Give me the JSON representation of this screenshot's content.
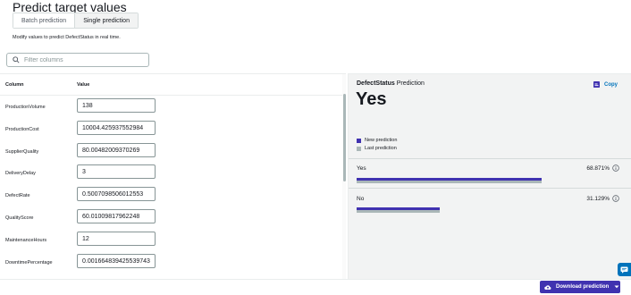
{
  "page": {
    "title": "Predict target values",
    "subtitle": "Modify values to predict DefectStatus in real time."
  },
  "tabs": [
    {
      "label": "Batch prediction",
      "active": false
    },
    {
      "label": "Single prediction",
      "active": true
    }
  ],
  "filter": {
    "placeholder": "Filter columns",
    "icon": "search-icon"
  },
  "table": {
    "column_header": "Column",
    "value_header": "Value",
    "rows": [
      {
        "column": "ProductionVolume",
        "value": "138"
      },
      {
        "column": "ProductionCost",
        "value": "10004.425937552984"
      },
      {
        "column": "SupplierQuality",
        "value": "80.00482009370269"
      },
      {
        "column": "DeliveryDelay",
        "value": "3"
      },
      {
        "column": "DefectRate",
        "value": "0.5007098506012553"
      },
      {
        "column": "QualityScore",
        "value": "60.01009817962248"
      },
      {
        "column": "MaintenanceHours",
        "value": "12"
      },
      {
        "column": "DowntimePercentage",
        "value": "0.0016648394255397436"
      }
    ]
  },
  "prediction": {
    "target_bold": "DefectStatus",
    "target_suffix": " Prediction",
    "copy_label": "Copy",
    "copy_icon": "copy-icon",
    "value": "Yes",
    "legend": [
      {
        "label": "New prediction",
        "color": "#4032b0"
      },
      {
        "label": "Last prediction",
        "color": "#aab7b8"
      }
    ],
    "classes": [
      {
        "label": "Yes",
        "pct_text": "68.871%",
        "new_fraction": 0.68871,
        "last_fraction": 0.68871
      },
      {
        "label": "No",
        "pct_text": "31.129%",
        "new_fraction": 0.31129,
        "last_fraction": 0.31129
      }
    ]
  },
  "footer": {
    "download_label": "Download prediction",
    "download_icon": "cloud-upload-icon",
    "dropdown_icon": "caret-down-icon",
    "chat_icon": "chat-icon"
  },
  "colors": {
    "accent": "#4032b0",
    "link": "#0073bb",
    "muted": "#aab7b8"
  }
}
